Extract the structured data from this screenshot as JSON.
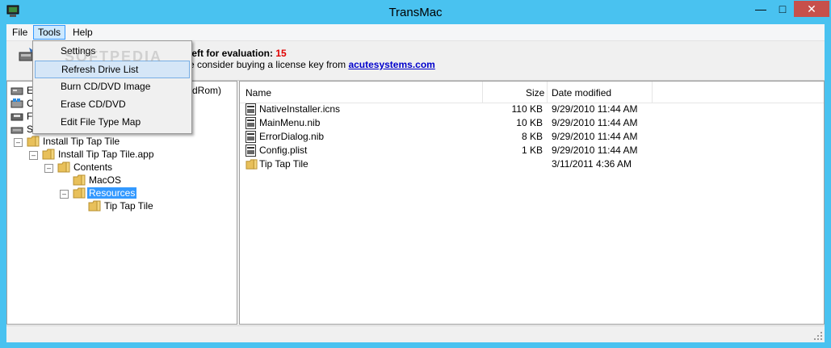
{
  "window": {
    "title": "TransMac"
  },
  "menubar": {
    "items": [
      "File",
      "Tools",
      "Help"
    ]
  },
  "tools_menu": {
    "items": [
      "Settings",
      "Refresh Drive List",
      "Burn CD/DVD Image",
      "Erase CD/DVD",
      "Edit File Type Map"
    ],
    "highlighted": "Refresh Drive List"
  },
  "info": {
    "eval_prefix": "left for evaluation: ",
    "eval_count": "15",
    "license_prefix": "e consider buying a license key from ",
    "license_link": "acutesystems.com"
  },
  "tree": {
    "devices": [
      {
        "label": "E",
        "icon": "drive-icon"
      },
      {
        "label": "C",
        "icon": "windows-drive-icon"
      },
      {
        "label": "F",
        "icon": "floppy-icon"
      },
      {
        "label": "S",
        "icon": "cd-drive-icon"
      }
    ],
    "device_suffix": "dRom)",
    "items": [
      "Install Tip Tap Tile",
      "Install Tip Tap Tile.app",
      "Contents",
      "MacOS",
      "Resources",
      "Tip Tap Tile"
    ],
    "selected": "Resources"
  },
  "list": {
    "columns": [
      "Name",
      "Size",
      "Date modified"
    ],
    "rows": [
      {
        "name": "NativeInstaller.icns",
        "size": "110 KB",
        "date": "9/29/2010 11:44 AM",
        "icon": "file-icon"
      },
      {
        "name": "MainMenu.nib",
        "size": "10 KB",
        "date": "9/29/2010 11:44 AM",
        "icon": "file-icon"
      },
      {
        "name": "ErrorDialog.nib",
        "size": "8 KB",
        "date": "9/29/2010 11:44 AM",
        "icon": "file-icon"
      },
      {
        "name": "Config.plist",
        "size": "1 KB",
        "date": "9/29/2010 11:44 AM",
        "icon": "file-icon"
      },
      {
        "name": "Tip Tap Tile",
        "size": "",
        "date": "3/11/2011 4:36 AM",
        "icon": "folder-icon"
      }
    ]
  },
  "colors": {
    "titlebar": "#49c2f0",
    "close": "#c7504b",
    "selection": "#3399ff",
    "link": "#0000cc",
    "eval_count": "#e00000"
  },
  "watermark": "SOFTPEDIA"
}
